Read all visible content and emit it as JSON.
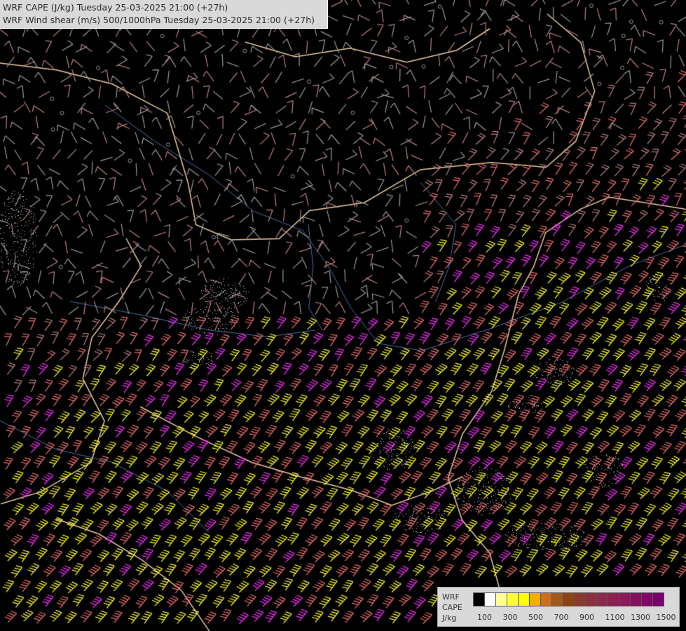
{
  "header": {
    "line1": "WRF CAPE (J/kg) Tuesday 25-03-2025 21:00 (+27h)",
    "line2": "WRF Wind shear (m/s) 500/1000hPa Tuesday 25-03-2025 21:00 (+27h)"
  },
  "legend": {
    "model": "WRF",
    "variable": "CAPE",
    "unit": "J/kg",
    "tick_labels": [
      "100",
      "300",
      "500",
      "700",
      "900",
      "1100",
      "1300",
      "1500"
    ],
    "swatch_colors": [
      "#000000",
      "#ffffff",
      "#ffff99",
      "#ffff33",
      "#ffff00",
      "#f0b000",
      "#c87020",
      "#a05a20",
      "#8b4513",
      "#8a3a2a",
      "#8c3040",
      "#8c2a4a",
      "#8c2050",
      "#8a1a5a",
      "#851060",
      "#800868",
      "#7a0070"
    ]
  },
  "map": {
    "barb_colors": {
      "weak": "#9a9a9a",
      "moderate": "#c08080",
      "strong": "#f07070",
      "very_strong": "#ff30ff",
      "extreme": "#ffff20"
    },
    "border_color": "#e8c9a0",
    "river_color": "#4a6ea8",
    "cape_hatch_color": "#bbbbbb"
  }
}
